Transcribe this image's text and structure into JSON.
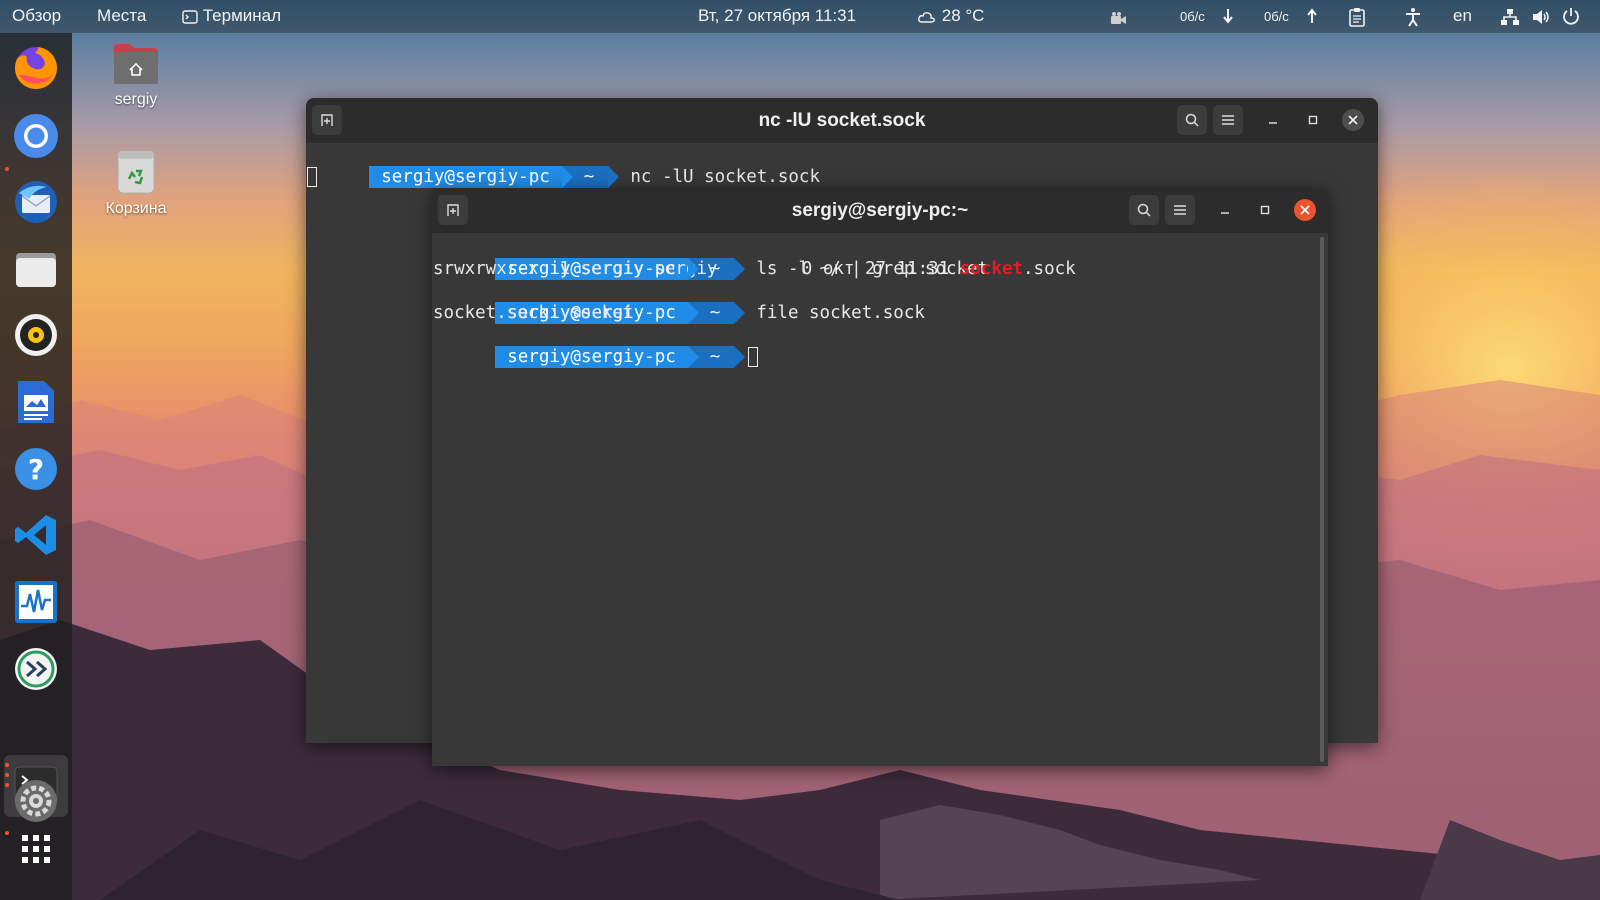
{
  "topbar": {
    "overview": "Обзор",
    "places": "Места",
    "app_name": "Терминал",
    "datetime": "Вт, 27 октября  11:31",
    "weather": "28 °C",
    "net_down": "0б/с",
    "net_up": "0б/с",
    "lang": "en"
  },
  "desktop": {
    "home_label": "sergiy",
    "trash_label": "Корзина"
  },
  "back_window": {
    "title": "nc -lU socket.sock",
    "prompt_user": "sergiy@sergiy-pc",
    "prompt_dir": "~",
    "command": "nc -lU socket.sock"
  },
  "front_window": {
    "title": "sergiy@sergiy-pc:~",
    "prompt_user": "sergiy@sergiy-pc",
    "prompt_dir": "~",
    "cmd1": "ls -l ~/ | grep socket",
    "out1_prefix": "srwxrwxr-x  1 sergiy sergiy        0 окт 27 11:31 ",
    "out1_match": "socket",
    "out1_suffix": ".sock",
    "cmd2": "file socket.sock",
    "out2": "socket.sock: socket"
  },
  "colors": {
    "prompt_user_bg": "#1f8de8",
    "prompt_dir_bg": "#1a6fc0",
    "grep_match": "#e51c23",
    "close_button": "#e9542e"
  }
}
